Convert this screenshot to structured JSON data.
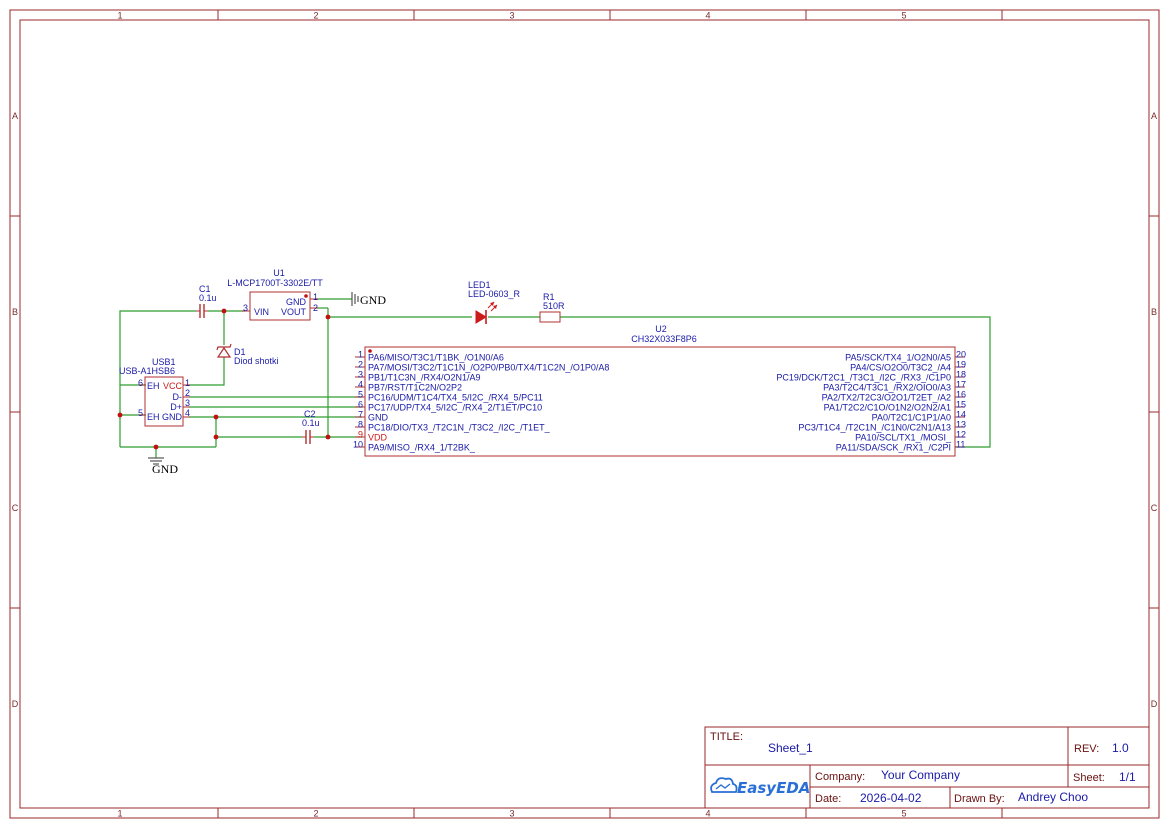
{
  "frame": {
    "columns": [
      "1",
      "2",
      "3",
      "4",
      "5"
    ],
    "rows": [
      "A",
      "B",
      "C",
      "D"
    ]
  },
  "components": {
    "u1": {
      "ref": "U1",
      "value": "L-MCP1700T-3302E/TT",
      "pin_gnd": "GND",
      "pin_vin": "VIN",
      "pin_vout": "VOUT",
      "num_1": "1",
      "num_2": "2",
      "num_3": "3"
    },
    "c1": {
      "ref": "C1",
      "value": "0.1u"
    },
    "c2": {
      "ref": "C2",
      "value": "0.1u"
    },
    "d1": {
      "ref": "D1",
      "value": "Diod shotki"
    },
    "led1": {
      "ref": "LED1",
      "value": "LED-0603_R"
    },
    "r1": {
      "ref": "R1",
      "value": "510R"
    },
    "usb1": {
      "ref": "USB1",
      "value": "USB-A1HSB6",
      "pins": [
        "VCC",
        "D-",
        "D+",
        "GND"
      ],
      "eh": "EH",
      "pin_nums": [
        "1",
        "2",
        "3",
        "4"
      ],
      "eh_nums": [
        "6",
        "5"
      ]
    },
    "u2": {
      "ref": "U2",
      "value": "CH32X033F8P6",
      "left_pins": [
        {
          "num": "1",
          "name": "PA6/MISO/T3C1/T1BK_/O1N0/A6"
        },
        {
          "num": "2",
          "name": "PA7/MOSI/T3C2/T1C1N_/O2P0/PB0/TX4/T1C2N_/O1P0/A8"
        },
        {
          "num": "3",
          "name": "PB1/T1C3N_/RX4/O2N1/A9"
        },
        {
          "num": "4",
          "name": "PB7/RST/T1C2N/O2P2"
        },
        {
          "num": "5",
          "name": "PC16/UDM/T1C4/TX4_5/I2C_/RX4_5/PC11"
        },
        {
          "num": "6",
          "name": "PC17/UDP/TX4_5/I2C_/RX4_2/T1ET/PC10"
        },
        {
          "num": "7",
          "name": "GND"
        },
        {
          "num": "8",
          "name": "PC18/DIO/TX3_/T2C1N_/T3C2_/I2C_/T1ET_"
        },
        {
          "num": "9",
          "name": "VDD"
        },
        {
          "num": "10",
          "name": "PA9/MISO_/RX4_1/T2BK_"
        }
      ],
      "right_pins": [
        {
          "num": "20",
          "name": "PA5/SCK/TX4_1/O2N0/A5"
        },
        {
          "num": "19",
          "name": "PA4/CS/O2O0/T3C2_/A4"
        },
        {
          "num": "18",
          "name": "PC19/DCK/T2C1_/T3C1_/I2C_/RX3_/C1P0"
        },
        {
          "num": "17",
          "name": "PA3/T2C4/T3C1_/RX2/OIO0/A3"
        },
        {
          "num": "16",
          "name": "PA2/TX2/T2C3/O2O1/T2ET_/A2"
        },
        {
          "num": "15",
          "name": "PA1/T2C2/C1O/O1N2/O2N2/A1"
        },
        {
          "num": "14",
          "name": "PA0/T2C1/C1P1/A0"
        },
        {
          "num": "13",
          "name": "PC3/T1C4_/T2C1N_/C1N0/C2N1/A13"
        },
        {
          "num": "12",
          "name": "PA10/SCL/TX1_/MOSI_"
        },
        {
          "num": "11",
          "name": "PA11/SDA/SCK_/RX1_/C2PI"
        }
      ]
    },
    "gnd_top": "GND",
    "gnd_bottom": "GND"
  },
  "title_block": {
    "title_label": "TITLE:",
    "title_value": "Sheet_1",
    "rev_label": "REV:",
    "rev_value": "1.0",
    "logo_text": "EasyEDA",
    "company_label": "Company:",
    "company_value": "Your Company",
    "sheet_label": "Sheet:",
    "sheet_value": "1/1",
    "date_label": "Date:",
    "date_value": "2026-04-02",
    "drawn_label": "Drawn By:",
    "drawn_value": "Andrey Choo"
  },
  "colors": {
    "frame": "#9a2a2a",
    "wire": "#2e9e2e",
    "part": "#b03030",
    "text": "#1a1aa8",
    "brand": "#2a6fd6"
  }
}
